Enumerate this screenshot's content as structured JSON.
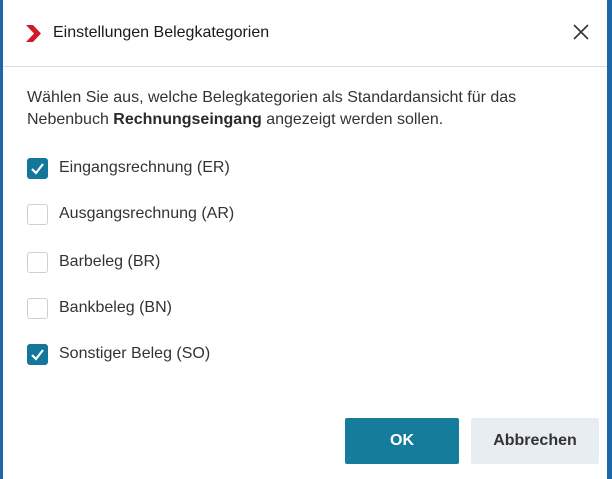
{
  "dialog": {
    "title": "Einstellungen Belegkategorien",
    "intro_part1": "Wählen Sie aus, welche Belegkategorien als Standardansicht für das Nebenbuch ",
    "intro_bold": "Rechnungseingang",
    "intro_part2": " angezeigt werden sollen."
  },
  "options": [
    {
      "label": "Eingangsrechnung (ER)",
      "checked": true
    },
    {
      "label": "Ausgangsrechnung (AR)",
      "checked": false
    },
    {
      "label": "Barbeleg (BR)",
      "checked": false
    },
    {
      "label": "Bankbeleg (BN)",
      "checked": false
    },
    {
      "label": "Sonstiger Beleg (SO)",
      "checked": true
    }
  ],
  "buttons": {
    "ok": "OK",
    "cancel": "Abbrechen"
  },
  "colors": {
    "accent": "#167c9b",
    "brand_red": "#d0192b",
    "window_border": "#1d67a8"
  },
  "icons": {
    "title": "app-logo-chevron-icon",
    "close": "close-icon",
    "check": "checkmark-icon"
  }
}
